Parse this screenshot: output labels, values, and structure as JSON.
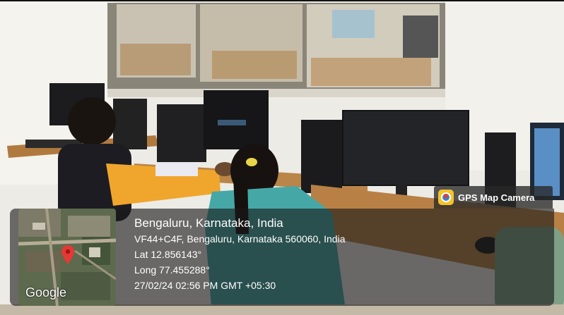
{
  "badge": {
    "label": "GPS Map Camera",
    "icon": "gps-map-camera-icon"
  },
  "location": {
    "title": "Bengaluru, Karnataka, India",
    "address": "VF44+C4F, Bengaluru, Karnataka 560060, India",
    "lat": "Lat 12.856143°",
    "long": "Long 77.455288°",
    "datetime": "27/02/24 02:56 PM GMT +05:30"
  },
  "map": {
    "attribution": "Google",
    "pin_color": "#e53935"
  }
}
